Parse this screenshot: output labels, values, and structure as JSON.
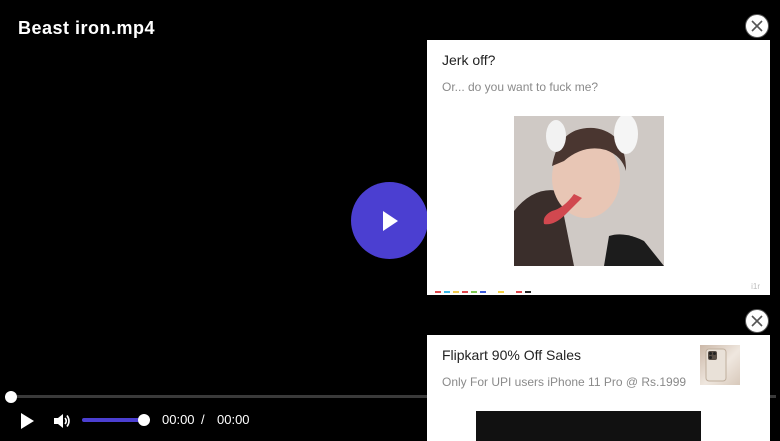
{
  "player": {
    "title": "Beast iron.mp4",
    "current_time": "00:00",
    "time_separator": "/",
    "duration": "00:00",
    "progress_fraction": 0,
    "volume_fraction": 1,
    "accent_color": "#4b3fd1"
  },
  "ads": [
    {
      "title": "Jerk off?",
      "subtitle": "Or... do you want to fuck me?",
      "mark": "i1r",
      "color_strip": [
        "#e0474c",
        "#39b6e6",
        "#f2c94c",
        "#e0474c",
        "#7ec850",
        "#3b5bdb",
        "#ffffff",
        "#f5d142",
        "#ffffff",
        "#e0474c",
        "#222222"
      ]
    },
    {
      "title": "Flipkart 90% Off Sales",
      "subtitle": "Only For UPI users iPhone 11 Pro @ Rs.1999"
    }
  ],
  "icons": {
    "big_play": "play-icon",
    "play": "play-icon",
    "volume": "volume-icon",
    "close": "close-icon"
  }
}
